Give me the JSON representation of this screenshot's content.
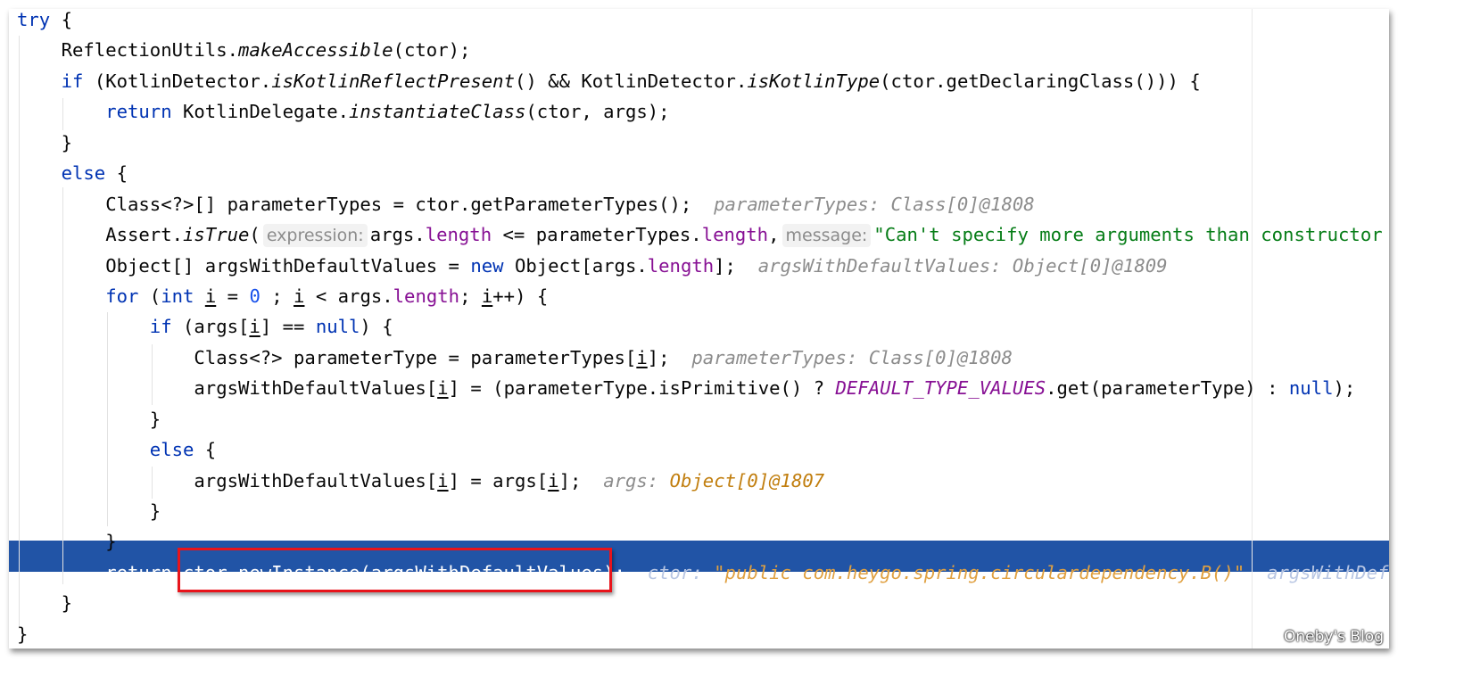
{
  "editor": {
    "highlighted_line": 18,
    "colors": {
      "keyword": "#0033b3",
      "field": "#871094",
      "string": "#067d17",
      "number": "#1750eb",
      "hint": "#8c8c8c",
      "hint_value": "#c17e0e",
      "execution_line": "#2154a6",
      "annotation_box": "#e8141b"
    },
    "lines": [
      {
        "indent": 0,
        "tokens": [
          [
            "try",
            "k"
          ],
          [
            " {",
            "p"
          ]
        ]
      },
      {
        "indent": 1,
        "tokens": [
          [
            "ReflectionUtils.",
            "p"
          ],
          [
            "makeAccessible",
            "i"
          ],
          [
            "(ctor);",
            "p"
          ]
        ]
      },
      {
        "indent": 1,
        "tokens": [
          [
            "if",
            "k"
          ],
          [
            " (KotlinDetector.",
            "p"
          ],
          [
            "isKotlinReflectPresent",
            "i"
          ],
          [
            "() && KotlinDetector.",
            "p"
          ],
          [
            "isKotlinType",
            "i"
          ],
          [
            "(ctor.getDeclaringClass())) {",
            "p"
          ]
        ]
      },
      {
        "indent": 2,
        "tokens": [
          [
            "return",
            "k"
          ],
          [
            " KotlinDelegate.",
            "p"
          ],
          [
            "instantiateClass",
            "i"
          ],
          [
            "(ctor, args);",
            "p"
          ]
        ]
      },
      {
        "indent": 1,
        "tokens": [
          [
            "}",
            "p"
          ]
        ]
      },
      {
        "indent": 1,
        "tokens": [
          [
            "else",
            "k"
          ],
          [
            " {",
            "p"
          ]
        ]
      },
      {
        "indent": 2,
        "tokens": [
          [
            "Class<?>[] parameterTypes = ctor.getParameterTypes();",
            "p"
          ],
          [
            "  parameterTypes: Class[0]@1808",
            "h"
          ]
        ]
      },
      {
        "indent": 2,
        "tokens": [
          [
            "Assert.",
            "p"
          ],
          [
            "isTrue",
            "i"
          ],
          [
            "(",
            "p"
          ],
          [
            "expression:",
            "b"
          ],
          [
            "args.",
            "p"
          ],
          [
            "length",
            "f"
          ],
          [
            " <= parameterTypes.",
            "p"
          ],
          [
            "length",
            "f"
          ],
          [
            ",",
            "p"
          ],
          [
            "message:",
            "b"
          ],
          [
            "\"Can't specify more arguments than constructor",
            "s"
          ]
        ]
      },
      {
        "indent": 2,
        "tokens": [
          [
            "Object[] argsWithDefaultValues = ",
            "p"
          ],
          [
            "new",
            "k"
          ],
          [
            " Object[args.",
            "p"
          ],
          [
            "length",
            "f"
          ],
          [
            "];",
            "p"
          ],
          [
            "  argsWithDefaultValues: Object[0]@1809",
            "h"
          ]
        ]
      },
      {
        "indent": 2,
        "tokens": [
          [
            "for",
            "k"
          ],
          [
            " (",
            "p"
          ],
          [
            "int",
            "k"
          ],
          [
            " ",
            "p"
          ],
          [
            "i",
            "u"
          ],
          [
            " = ",
            "p"
          ],
          [
            "0",
            "n"
          ],
          [
            " ; ",
            "p"
          ],
          [
            "i",
            "u"
          ],
          [
            " < args.",
            "p"
          ],
          [
            "length",
            "f"
          ],
          [
            "; ",
            "p"
          ],
          [
            "i",
            "u"
          ],
          [
            "++) {",
            "p"
          ]
        ]
      },
      {
        "indent": 3,
        "tokens": [
          [
            "if",
            "k"
          ],
          [
            " (args[",
            "p"
          ],
          [
            "i",
            "u"
          ],
          [
            "] == ",
            "p"
          ],
          [
            "null",
            "k"
          ],
          [
            ") {",
            "p"
          ]
        ]
      },
      {
        "indent": 4,
        "tokens": [
          [
            "Class<?> parameterType = parameterTypes[",
            "p"
          ],
          [
            "i",
            "u"
          ],
          [
            "];",
            "p"
          ],
          [
            "  parameterTypes: Class[0]@1808",
            "h"
          ]
        ]
      },
      {
        "indent": 4,
        "tokens": [
          [
            "argsWithDefaultValues[",
            "p"
          ],
          [
            "i",
            "u"
          ],
          [
            "] = (parameterType.isPrimitive() ? ",
            "p"
          ],
          [
            "DEFAULT_TYPE_VALUES",
            "fi"
          ],
          [
            ".get(parameterType) : ",
            "p"
          ],
          [
            "null",
            "k"
          ],
          [
            ");",
            "p"
          ]
        ]
      },
      {
        "indent": 3,
        "tokens": [
          [
            "}",
            "p"
          ]
        ]
      },
      {
        "indent": 3,
        "tokens": [
          [
            "else",
            "k"
          ],
          [
            " {",
            "p"
          ]
        ]
      },
      {
        "indent": 4,
        "tokens": [
          [
            "argsWithDefaultValues[",
            "p"
          ],
          [
            "i",
            "u"
          ],
          [
            "] = args[",
            "p"
          ],
          [
            "i",
            "u"
          ],
          [
            "];",
            "p"
          ],
          [
            "  args: ",
            "h"
          ],
          [
            "Object[0]@1807",
            "o"
          ]
        ]
      },
      {
        "indent": 3,
        "tokens": [
          [
            "}",
            "p"
          ]
        ]
      },
      {
        "indent": 2,
        "tokens": [
          [
            "}",
            "p"
          ]
        ]
      },
      {
        "indent": 2,
        "tokens": [
          [
            "return ctor.newInstance(argsWithDefaultValues);",
            "p"
          ],
          [
            "  ctor: ",
            "h"
          ],
          [
            "\"public com.heygo.spring.circulardependency.B()\"",
            "o"
          ],
          [
            "  ",
            "p"
          ],
          [
            "argsWithDefa",
            "h"
          ]
        ]
      },
      {
        "indent": 1,
        "tokens": [
          [
            "}",
            "p"
          ]
        ]
      },
      {
        "indent": 0,
        "tokens": [
          [
            "}",
            "p"
          ]
        ]
      }
    ]
  },
  "watermark": "Oneby's Blog"
}
